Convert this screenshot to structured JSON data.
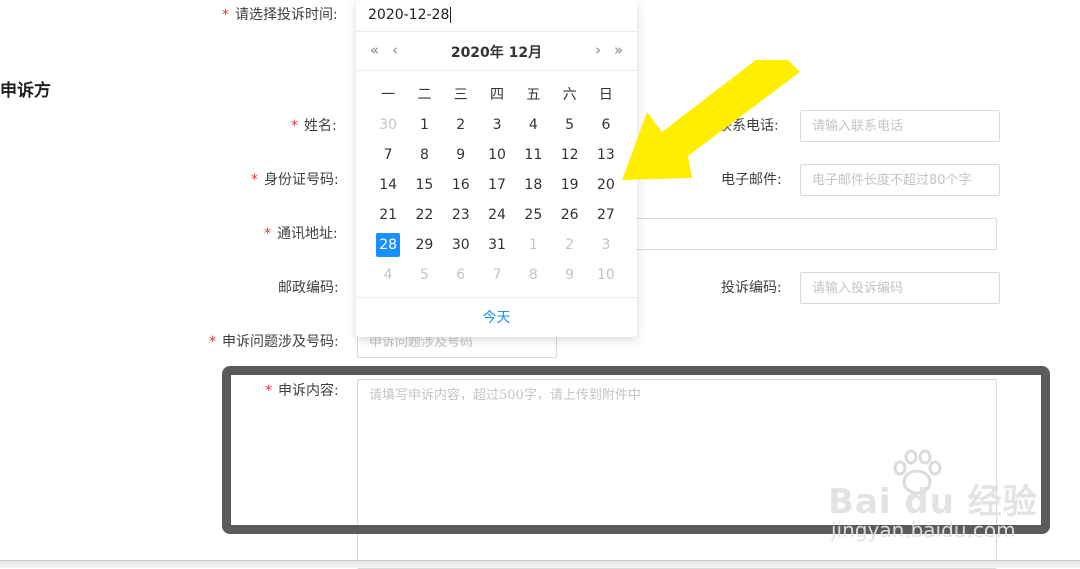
{
  "top_field": {
    "label": "请选择投诉时间:"
  },
  "section": {
    "title": "申诉方"
  },
  "form": {
    "name_label": "姓名:",
    "phone_label": "联系电话:",
    "phone_placeholder": "请输入联系电话",
    "id_label": "身份证号码:",
    "email_label": "电子邮件:",
    "email_placeholder": "电子邮件长度不超过80个字",
    "address_label": "通讯地址:",
    "postcode_label": "邮政编码:",
    "complaint_code_label": "投诉编码:",
    "complaint_code_placeholder": "请输入投诉编码",
    "number_label": "申诉问题涉及号码:",
    "number_placeholder": "申诉问题涉及号码",
    "content_label": "申诉内容:",
    "content_placeholder": "请填写申诉内容，超过500字，请上传到附件中"
  },
  "calendar": {
    "input_value": "2020-12-28",
    "title": "2020年 12月",
    "prev_year": "«",
    "prev_month": "‹",
    "next_month": "›",
    "next_year": "»",
    "weekdays": [
      "一",
      "二",
      "三",
      "四",
      "五",
      "六",
      "日"
    ],
    "weeks": [
      [
        "30",
        "1",
        "2",
        "3",
        "4",
        "5",
        "6"
      ],
      [
        "7",
        "8",
        "9",
        "10",
        "11",
        "12",
        "13"
      ],
      [
        "14",
        "15",
        "16",
        "17",
        "18",
        "19",
        "20"
      ],
      [
        "21",
        "22",
        "23",
        "24",
        "25",
        "26",
        "27"
      ],
      [
        "28",
        "29",
        "30",
        "31",
        "1",
        "2",
        "3"
      ],
      [
        "4",
        "5",
        "6",
        "7",
        "8",
        "9",
        "10"
      ]
    ],
    "other_month": [
      [
        0
      ],
      [],
      [],
      [],
      [
        4,
        5,
        6
      ],
      [
        0,
        1,
        2,
        3,
        4,
        5,
        6
      ]
    ],
    "selected": [
      4,
      0
    ],
    "today_label": "今天"
  },
  "watermark": {
    "brand": "Bai du 经验",
    "url": "jingyan.baidu.com"
  },
  "colors": {
    "accent": "#1890ff",
    "required": "#e8343a",
    "arrow": "#ffee00",
    "highlight_border": "#5b5b5b"
  }
}
